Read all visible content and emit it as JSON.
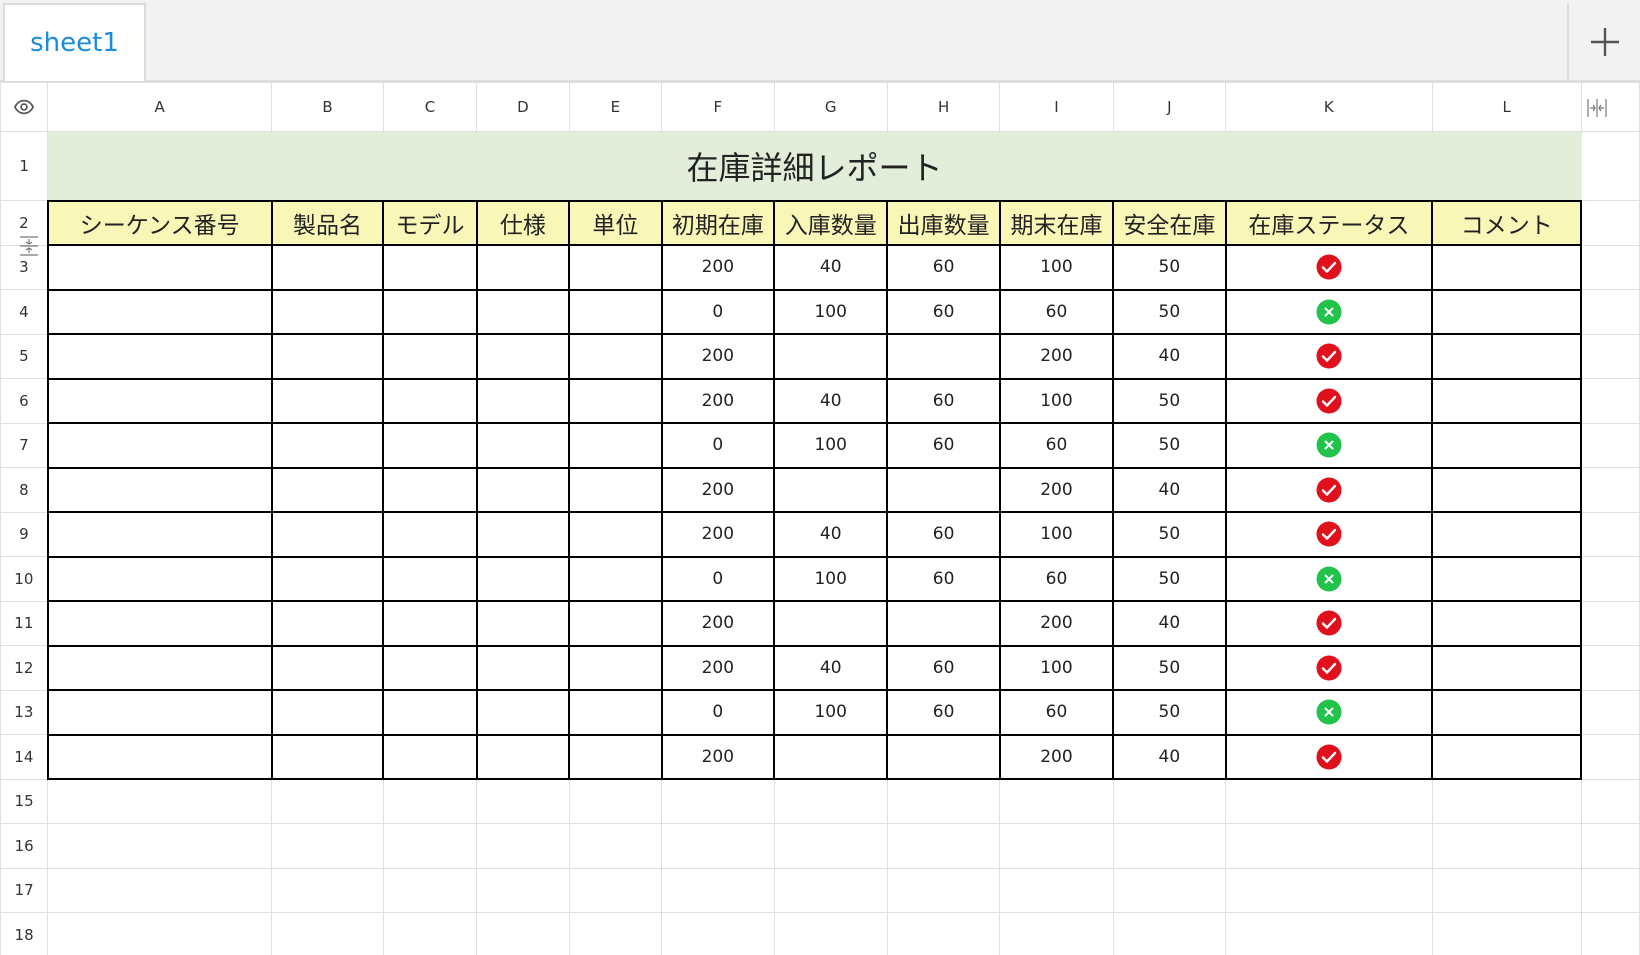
{
  "tabs": {
    "sheet_label": "sheet1"
  },
  "columns": [
    "A",
    "B",
    "C",
    "D",
    "E",
    "F",
    "G",
    "H",
    "I",
    "J",
    "K",
    "L"
  ],
  "title": "在庫詳細レポート",
  "headers": [
    "シーケンス番号",
    "製品名",
    "モデル",
    "仕様",
    "単位",
    "初期在庫",
    "入庫数量",
    "出庫数量",
    "期末在庫",
    "安全在庫",
    "在庫ステータス",
    "コメント"
  ],
  "rows": [
    {
      "num": "3",
      "initial": "200",
      "in": "40",
      "out": "60",
      "end": "100",
      "safety": "50",
      "status": "ok"
    },
    {
      "num": "4",
      "initial": "0",
      "in": "100",
      "out": "60",
      "end": "60",
      "safety": "50",
      "status": "low"
    },
    {
      "num": "5",
      "initial": "200",
      "in": "",
      "out": "",
      "end": "200",
      "safety": "40",
      "status": "ok"
    },
    {
      "num": "6",
      "initial": "200",
      "in": "40",
      "out": "60",
      "end": "100",
      "safety": "50",
      "status": "ok"
    },
    {
      "num": "7",
      "initial": "0",
      "in": "100",
      "out": "60",
      "end": "60",
      "safety": "50",
      "status": "low"
    },
    {
      "num": "8",
      "initial": "200",
      "in": "",
      "out": "",
      "end": "200",
      "safety": "40",
      "status": "ok"
    },
    {
      "num": "9",
      "initial": "200",
      "in": "40",
      "out": "60",
      "end": "100",
      "safety": "50",
      "status": "ok"
    },
    {
      "num": "10",
      "initial": "0",
      "in": "100",
      "out": "60",
      "end": "60",
      "safety": "50",
      "status": "low"
    },
    {
      "num": "11",
      "initial": "200",
      "in": "",
      "out": "",
      "end": "200",
      "safety": "40",
      "status": "ok"
    },
    {
      "num": "12",
      "initial": "200",
      "in": "40",
      "out": "60",
      "end": "100",
      "safety": "50",
      "status": "ok"
    },
    {
      "num": "13",
      "initial": "0",
      "in": "100",
      "out": "60",
      "end": "60",
      "safety": "50",
      "status": "low"
    },
    {
      "num": "14",
      "initial": "200",
      "in": "",
      "out": "",
      "end": "200",
      "safety": "40",
      "status": "ok"
    }
  ],
  "row_numbers": {
    "r1": "1",
    "r2": "2",
    "empty": [
      "15",
      "16",
      "17",
      "18"
    ]
  },
  "status_icons": {
    "ok": "red-check-icon",
    "low": "green-x-icon"
  },
  "colors": {
    "title_bg": "#e2eed9",
    "header_bg": "#f8f7b8",
    "tab_text": "#1a8ce0",
    "status_ok": "#e0101d",
    "status_low": "#22c34a"
  }
}
